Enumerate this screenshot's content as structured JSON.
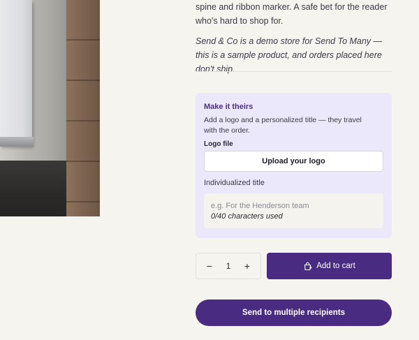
{
  "product": {
    "description": "spine and ribbon marker. A safe bet for the reader who's hard to shop for.",
    "demo_note": "Send & Co is a demo store for Send To Many — this is a sample product, and orders placed here don't ship."
  },
  "personalize": {
    "title": "Make it theirs",
    "subtitle": "Add a logo and a personalized title — they travel with the order.",
    "logo_label": "Logo file",
    "upload_button": "Upload your logo",
    "title_label": "Individualized title",
    "title_placeholder": "e.g. For the Henderson team",
    "title_value": "",
    "char_count": "0/40 characters used"
  },
  "quantity": {
    "decrement": "−",
    "value": "1",
    "increment": "+"
  },
  "actions": {
    "add_to_cart": "Add to cart",
    "send_multiple": "Send to multiple recipients"
  },
  "colors": {
    "accent": "#4a2b82",
    "card_background": "#ece8fb",
    "page_background": "#f5f4ef"
  },
  "icons": {
    "add_to_cart": "shopping-bag-plus-icon"
  }
}
